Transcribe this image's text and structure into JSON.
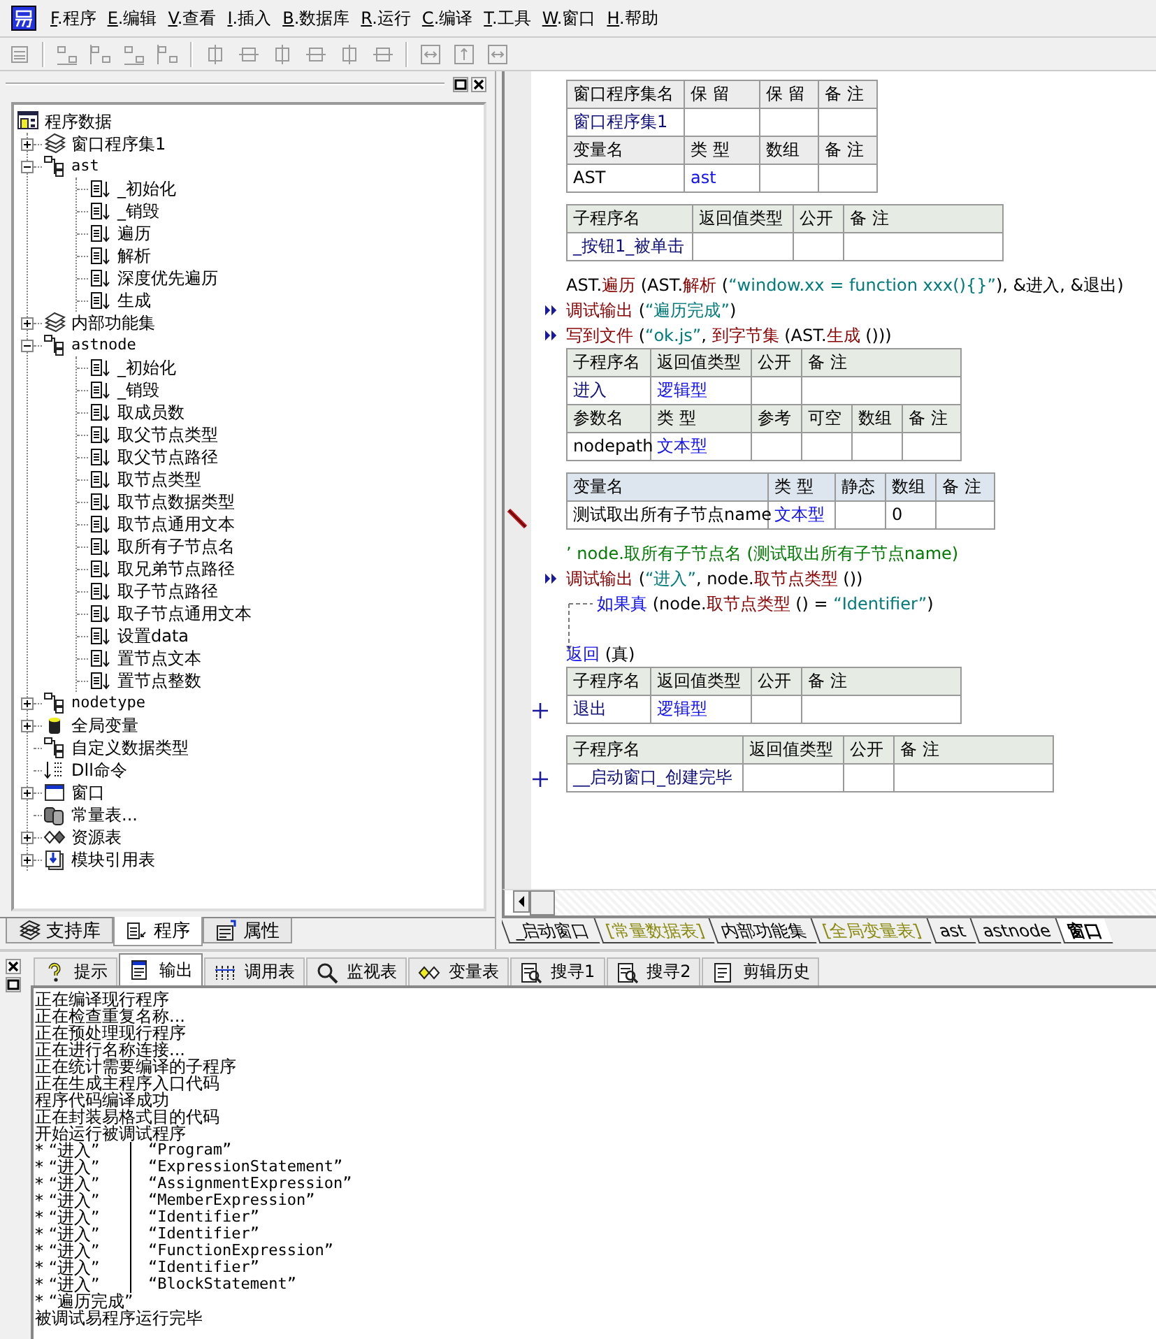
{
  "menu": [
    {
      "label": "F.程序"
    },
    {
      "label": "E.编辑"
    },
    {
      "label": "V.查看"
    },
    {
      "label": "I.插入"
    },
    {
      "label": "B.数据库"
    },
    {
      "label": "R.运行"
    },
    {
      "label": "C.编译"
    },
    {
      "label": "T.工具"
    },
    {
      "label": "W.窗口"
    },
    {
      "label": "H.帮助"
    }
  ],
  "tree": {
    "root": "程序数据",
    "items": [
      {
        "label": "窗口程序集1",
        "kind": "set",
        "expanded": false
      },
      {
        "label": "ast",
        "kind": "class",
        "expanded": true,
        "children": [
          {
            "label": "_初始化",
            "kind": "method"
          },
          {
            "label": "_销毁",
            "kind": "method"
          },
          {
            "label": "遍历",
            "kind": "method"
          },
          {
            "label": "解析",
            "kind": "method"
          },
          {
            "label": "深度优先遍历",
            "kind": "method"
          },
          {
            "label": "生成",
            "kind": "method"
          }
        ]
      },
      {
        "label": "内部功能集",
        "kind": "set",
        "expanded": false
      },
      {
        "label": "astnode",
        "kind": "class",
        "expanded": true,
        "children": [
          {
            "label": "_初始化",
            "kind": "method"
          },
          {
            "label": "_销毁",
            "kind": "method"
          },
          {
            "label": "取成员数",
            "kind": "method"
          },
          {
            "label": "取父节点类型",
            "kind": "method"
          },
          {
            "label": "取父节点路径",
            "kind": "method"
          },
          {
            "label": "取节点类型",
            "kind": "method"
          },
          {
            "label": "取节点数据类型",
            "kind": "method"
          },
          {
            "label": "取节点通用文本",
            "kind": "method"
          },
          {
            "label": "取所有子节点名",
            "kind": "method"
          },
          {
            "label": "取兄弟节点路径",
            "kind": "method"
          },
          {
            "label": "取子节点路径",
            "kind": "method"
          },
          {
            "label": "取子节点通用文本",
            "kind": "method"
          },
          {
            "label": "设置data",
            "kind": "method"
          },
          {
            "label": "置节点文本",
            "kind": "method"
          },
          {
            "label": "置节点整数",
            "kind": "method"
          }
        ]
      },
      {
        "label": "nodetype",
        "kind": "class",
        "expanded": false
      },
      {
        "label": "全局变量",
        "kind": "global",
        "expanded": false
      },
      {
        "label": "自定义数据类型",
        "kind": "class"
      },
      {
        "label": "Dll命令",
        "kind": "dll"
      },
      {
        "label": "窗口",
        "kind": "window",
        "expanded": false
      },
      {
        "label": "常量表...",
        "kind": "constant"
      },
      {
        "label": "资源表",
        "kind": "resource",
        "expanded": false
      },
      {
        "label": "模块引用表",
        "kind": "module",
        "expanded": false
      }
    ]
  },
  "left_tabs": [
    {
      "label": "支持库",
      "selected": false
    },
    {
      "label": "程序",
      "selected": true
    },
    {
      "label": "属性",
      "selected": false
    }
  ],
  "editor": {
    "blocks": [
      {
        "kind": "assembly",
        "rows": [
          {
            "header": true,
            "cells": [
              {
                "text": "窗口程序集名"
              },
              {
                "text": "保 留"
              },
              {
                "text": "保 留"
              },
              {
                "text": "备 注"
              }
            ]
          },
          {
            "header": false,
            "cells": [
              {
                "text": "窗口程序集1",
                "kind": "name"
              }
            ]
          },
          {
            "header": true,
            "cells": [
              {
                "text": "变量名"
              },
              {
                "text": "类 型"
              },
              {
                "text": "数组"
              },
              {
                "text": "备 注"
              }
            ]
          },
          {
            "header": false,
            "cells": [
              {
                "text": "AST"
              },
              {
                "text": "ast",
                "kind": "type"
              }
            ]
          }
        ]
      },
      {
        "kind": "subroutine",
        "collapsed": false,
        "rows": [
          {
            "header": true,
            "cells": [
              {
                "text": "子程序名"
              },
              {
                "text": "返回值类型"
              },
              {
                "text": "公开"
              },
              {
                "text": "备 注"
              }
            ]
          },
          {
            "header": false,
            "cells": [
              {
                "text": "_按钮1_被单击",
                "kind": "name"
              }
            ]
          }
        ]
      },
      {
        "kind": "code",
        "marked": false,
        "parts": [
          {
            "text": "AST.",
            "kind": "plain"
          },
          {
            "text": "遍历",
            "kind": "command"
          },
          {
            "text": " (AST.",
            "kind": "plain"
          },
          {
            "text": "解析",
            "kind": "command"
          },
          {
            "text": " (",
            "kind": "plain"
          },
          {
            "text": "“window.xx = function xxx(){}”",
            "kind": "string"
          },
          {
            "text": "), &进入, &退出)",
            "kind": "plain"
          }
        ]
      },
      {
        "kind": "code",
        "marked": true,
        "parts": [
          {
            "text": "调试输出",
            "kind": "command"
          },
          {
            "text": " (",
            "kind": "plain"
          },
          {
            "text": "“遍历完成”",
            "kind": "string"
          },
          {
            "text": ")",
            "kind": "plain"
          }
        ]
      },
      {
        "kind": "code",
        "marked": true,
        "parts": [
          {
            "text": "写到文件",
            "kind": "command"
          },
          {
            "text": " (",
            "kind": "plain"
          },
          {
            "text": "“ok.js”",
            "kind": "string"
          },
          {
            "text": ", ",
            "kind": "plain"
          },
          {
            "text": "到字节集",
            "kind": "command"
          },
          {
            "text": " (AST.",
            "kind": "plain"
          },
          {
            "text": "生成",
            "kind": "command"
          },
          {
            "text": " ()))",
            "kind": "plain"
          }
        ]
      },
      {
        "kind": "subroutine",
        "collapsed": false,
        "rows": [
          {
            "header": true,
            "cells": [
              {
                "text": "子程序名"
              },
              {
                "text": "返回值类型"
              },
              {
                "text": "公开"
              },
              {
                "text": "备 注"
              }
            ]
          },
          {
            "header": false,
            "cells": [
              {
                "text": "进入",
                "kind": "name"
              },
              {
                "text": "逻辑型",
                "kind": "type"
              }
            ]
          },
          {
            "header": true,
            "cells": [
              {
                "text": "参数名"
              },
              {
                "text": "类 型"
              },
              {
                "text": "参考"
              },
              {
                "text": "可空"
              },
              {
                "text": "数组"
              },
              {
                "text": "备 注"
              }
            ]
          },
          {
            "header": false,
            "cells": [
              {
                "text": "nodepath"
              },
              {
                "text": "文本型",
                "kind": "type"
              }
            ]
          }
        ]
      },
      {
        "kind": "locals",
        "rows": [
          {
            "header": true,
            "cells": [
              {
                "text": "变量名"
              },
              {
                "text": "类 型"
              },
              {
                "text": "静态"
              },
              {
                "text": "数组"
              },
              {
                "text": "备 注"
              }
            ]
          },
          {
            "header": false,
            "cells": [
              {
                "text": "测试取出所有子节点name"
              },
              {
                "text": "文本型",
                "kind": "type"
              },
              null,
              {
                "text": "0"
              }
            ]
          }
        ]
      },
      {
        "kind": "code",
        "marked": false,
        "parts": [
          {
            "text": "’ node.取所有子节点名 (测试取出所有子节点name)",
            "kind": "comment"
          }
        ]
      },
      {
        "kind": "code",
        "marked": true,
        "parts": [
          {
            "text": "调试输出",
            "kind": "command"
          },
          {
            "text": " (",
            "kind": "plain"
          },
          {
            "text": "“进入”",
            "kind": "string"
          },
          {
            "text": ", node.",
            "kind": "plain"
          },
          {
            "text": "取节点类型",
            "kind": "command"
          },
          {
            "text": " ())",
            "kind": "plain"
          }
        ]
      },
      {
        "kind": "if",
        "marked": false,
        "parts": [
          {
            "text": "如果真",
            "kind": "flow"
          },
          {
            "text": " (node.",
            "kind": "plain"
          },
          {
            "text": "取节点类型",
            "kind": "command"
          },
          {
            "text": " () = ",
            "kind": "plain"
          },
          {
            "text": "“Identifier”",
            "kind": "string"
          },
          {
            "text": ")",
            "kind": "plain"
          }
        ]
      },
      {
        "kind": "code",
        "marked": false,
        "parts": [
          {
            "text": "返回",
            "kind": "flow"
          },
          {
            "text": " (真)",
            "kind": "plain"
          }
        ]
      },
      {
        "kind": "subroutine",
        "collapsed": true,
        "rows": [
          {
            "header": true,
            "cells": [
              {
                "text": "子程序名"
              },
              {
                "text": "返回值类型"
              },
              {
                "text": "公开"
              },
              {
                "text": "备 注"
              }
            ]
          },
          {
            "header": false,
            "cells": [
              {
                "text": "退出",
                "kind": "name"
              },
              {
                "text": "逻辑型",
                "kind": "type"
              }
            ]
          }
        ]
      },
      {
        "kind": "subroutine",
        "collapsed": true,
        "rows": [
          {
            "header": true,
            "cells": [
              {
                "text": "子程序名"
              },
              {
                "text": "返回值类型"
              },
              {
                "text": "公开"
              },
              {
                "text": "备 注"
              }
            ]
          },
          {
            "header": false,
            "cells": [
              {
                "text": "__启动窗口_创建完毕",
                "kind": "name"
              }
            ]
          }
        ]
      }
    ],
    "tabs": [
      {
        "label": "_启动窗口",
        "kind": "code",
        "selected": false
      },
      {
        "label": "[常量数据表]",
        "kind": "data",
        "selected": false
      },
      {
        "label": "内部功能集",
        "kind": "code",
        "selected": false
      },
      {
        "label": "[全局变量表]",
        "kind": "data",
        "selected": false
      },
      {
        "label": "ast",
        "kind": "code",
        "selected": false
      },
      {
        "label": "astnode",
        "kind": "code",
        "selected": false
      },
      {
        "label": "窗口",
        "kind": "code",
        "selected": true
      }
    ]
  },
  "output": {
    "tabs": [
      {
        "label": "提示",
        "selected": false
      },
      {
        "label": "输出",
        "selected": true
      },
      {
        "label": "调用表",
        "selected": false
      },
      {
        "label": "监视表",
        "selected": false
      },
      {
        "label": "变量表",
        "selected": false
      },
      {
        "label": "搜寻1",
        "selected": false
      },
      {
        "label": "搜寻2",
        "selected": false
      },
      {
        "label": "剪辑历史",
        "selected": false
      }
    ],
    "lines": [
      {
        "text": "正在编译现行程序"
      },
      {
        "text": "正在检查重复名称..."
      },
      {
        "text": "正在预处理现行程序"
      },
      {
        "text": "正在进行名称连接..."
      },
      {
        "text": "正在统计需要编译的子程序"
      },
      {
        "text": "正在生成主程序入口代码"
      },
      {
        "text": "程序代码编译成功"
      },
      {
        "text": "正在封装易格式目的代码"
      },
      {
        "text": "开始运行被调试程序"
      },
      {
        "text": "* “进入”",
        "value": "“Program”"
      },
      {
        "text": "* “进入”",
        "value": "“ExpressionStatement”"
      },
      {
        "text": "* “进入”",
        "value": "“AssignmentExpression”"
      },
      {
        "text": "* “进入”",
        "value": "“MemberExpression”"
      },
      {
        "text": "* “进入”",
        "value": "“Identifier”"
      },
      {
        "text": "* “进入”",
        "value": "“Identifier”"
      },
      {
        "text": "* “进入”",
        "value": "“FunctionExpression”"
      },
      {
        "text": "* “进入”",
        "value": "“Identifier”"
      },
      {
        "text": "* “进入”",
        "value": "“BlockStatement”"
      },
      {
        "text": "* “遍历完成”"
      },
      {
        "text": "被调试易程序运行完毕"
      }
    ]
  }
}
